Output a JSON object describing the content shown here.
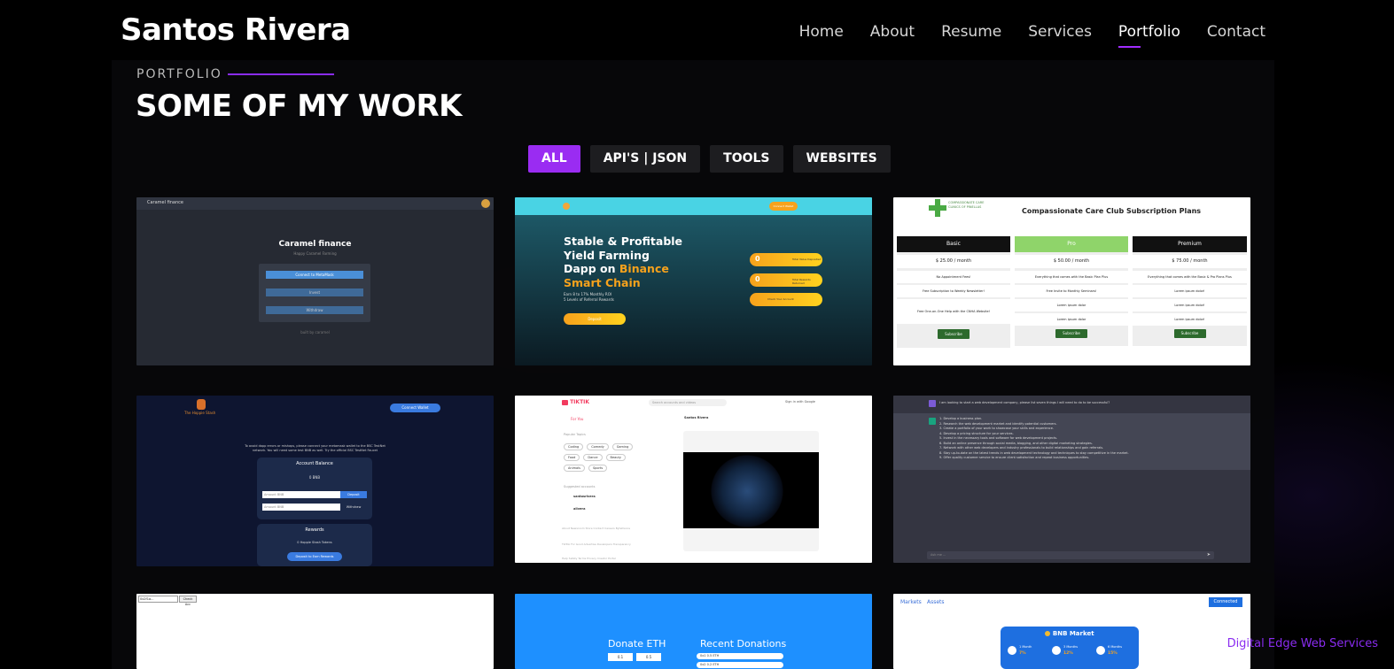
{
  "brand": {
    "name": "Santos Rivera"
  },
  "nav": {
    "items": [
      {
        "label": "Home"
      },
      {
        "label": "About"
      },
      {
        "label": "Resume"
      },
      {
        "label": "Services"
      },
      {
        "label": "Portfolio",
        "active": true
      },
      {
        "label": "Contact"
      }
    ]
  },
  "section": {
    "label": "PORTFOLIO",
    "title": "SOME OF MY WORK"
  },
  "filters": [
    {
      "label": "ALL",
      "active": true
    },
    {
      "label": "API'S | JSON"
    },
    {
      "label": "TOOLS"
    },
    {
      "label": "WEBSITES"
    }
  ],
  "cards": {
    "caramel": {
      "topbar": "Caramel finance",
      "title": "Caramel finance",
      "subtitle": "Happy Caramel Farming",
      "btn1": "Connect to MetaMask",
      "btn2": "Invest",
      "btn3": "Withdraw",
      "foot": "built by caramel"
    },
    "yield": {
      "header_btn": "Connect Wallet",
      "line1": "Stable & Profitable",
      "line2": "Yield Farming",
      "line3a": "Dapp on ",
      "line3b": "Binance",
      "line4": "Smart Chain",
      "small1": "Earn 8 to 17% Monthly ROI",
      "small2": "5 Levels of Referral Rewards",
      "deposit": "Deposit",
      "stat1": "Total Value Deposited",
      "stat2": "Total Rewards Returned",
      "stat3": "Check Your Account",
      "zero": "0"
    },
    "compassionate": {
      "logo": "COMPASSIONATE CARE CLINICS OF PINELLAS",
      "title": "Compassionate Care Club Subscription Plans",
      "plans": [
        {
          "name": "Basic",
          "price": "$ 25.00 / month",
          "rows": [
            "No Appointment Fees!",
            "Free Subscription to Weekly Newsletter!",
            "Free One-on-One Help with the CNHA Website!"
          ],
          "btn": "Subscribe"
        },
        {
          "name": "Pro",
          "price": "$ 50.00 / month",
          "rows": [
            "Everything that comes with the Basic Plan Plus",
            "Free Invite to Monthly Seminars!",
            "Lorem ipsum dolor",
            "Lorem ipsum dolor"
          ],
          "btn": "Subscribe"
        },
        {
          "name": "Premium",
          "price": "$ 75.00 / month",
          "rows": [
            "Everything that comes with the Basic & Pro Plans Plus",
            "Lorem ipsum dolor!",
            "Lorem ipsum dolor!",
            "Lorem ipsum dolor!"
          ],
          "btn": "Subscribe"
        }
      ]
    },
    "hippie": {
      "logo": "The Hoppie Stash",
      "connect": "Connect Wallet",
      "notice": "To avoid dapp errors or mishaps, please connect your metamask wallet to the BSC TestNet network. You will need some test BNB as well. Try the official BSC TestNet Faucet",
      "balance_title": "Account Balance",
      "balance_val": "0 BNB",
      "dep_placeholder": "Amount BNB",
      "dep_btn": "Deposit",
      "wd_placeholder": "Amount BNB",
      "wd_btn": "Withdraw",
      "rewards_title": "Rewards",
      "rewards_val": "0 Hoppie Stash Tokens",
      "rewards_btn": "Deposit to Earn Rewards"
    },
    "tiktik": {
      "logo": "TIKTIK",
      "search": "Search accounts and videos",
      "signin": "Sign in with Google",
      "foryou": "For You",
      "popular": "Popular Topics",
      "topics": [
        "Coding",
        "Comedy",
        "Gaming",
        "Food",
        "Dance",
        "Beauty",
        "Animals",
        "Sports"
      ],
      "suggested": "Suggested accounts",
      "acc1": "santosrivera",
      "acc2": "alivera",
      "post_user": "Santos Rivera",
      "footer1": "About Newsroom Store Contact Careers ByteDance",
      "footer2": "TikTok For Good Advertise Developers Transparency",
      "footer3": "Help Safety Terms Privacy Creator Portal"
    },
    "chat": {
      "question": "I am looking to start a web development company, please list seven things I will need to do to be successful?",
      "answers": [
        "1. Develop a business plan.",
        "2. Research the web development market and identify potential customers.",
        "3. Create a portfolio of your work to showcase your skills and experience.",
        "4. Develop a pricing structure for your services.",
        "5. Invest in the necessary tools and software for web development projects.",
        "6. Build an online presence through social media, blogging, and other digital marketing strategies.",
        "7. Network with other web developers and industry professionals to build relationships and gain referrals.",
        "8. Stay up-to-date on the latest trends in web development technology and techniques to stay competitive in the market.",
        "9. Offer quality customer service to ensure client satisfaction and repeat business opportunities."
      ],
      "input_placeholder": "Ask me ..."
    },
    "blank": {
      "input_val": "0x2f1a...",
      "btn": "Check Acc"
    },
    "donate": {
      "left": "Donate ETH",
      "right": "Recent Donations",
      "field1": "0.1",
      "field2": "0.5",
      "row1": "0x1 0.5 ETH",
      "row2": "0x2 0.2 ETH"
    },
    "bnb": {
      "tab1": "Markets",
      "tab2": "Assets",
      "connected": "Connected",
      "title": "BNB Market",
      "stats": [
        {
          "label": "1 Month",
          "value": "7%"
        },
        {
          "label": "3 Months",
          "value": "12%"
        },
        {
          "label": "6 Months",
          "value": "15%"
        }
      ]
    }
  },
  "footer": {
    "credit": "Digital Edge Web Services"
  },
  "colors": {
    "accent": "#9a2cf2",
    "background": "#000000"
  }
}
